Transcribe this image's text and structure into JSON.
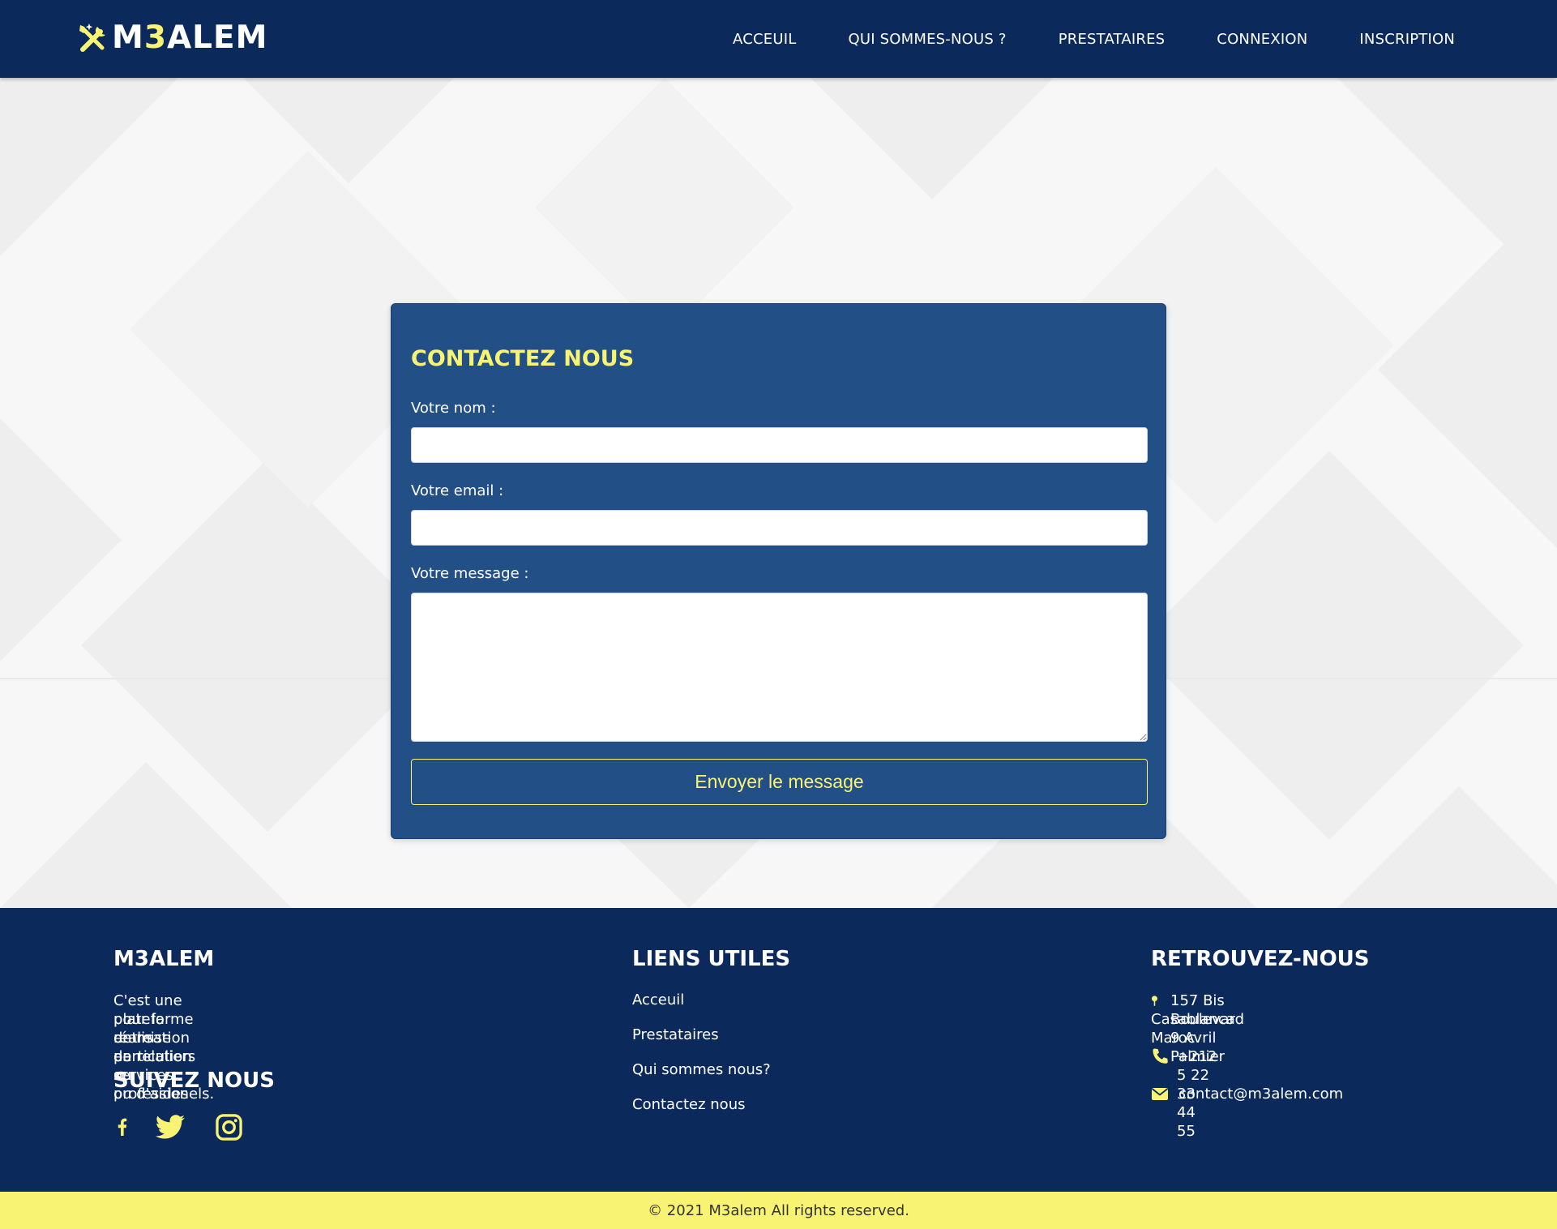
{
  "header": {
    "logo": {
      "prefix": "M",
      "accent": "3",
      "suffix": "ALEM"
    },
    "nav": [
      {
        "label": "ACCEUIL"
      },
      {
        "label": "QUI SOMMES-NOUS ?"
      },
      {
        "label": "PRESTATAIRES"
      },
      {
        "label": "CONNEXION"
      },
      {
        "label": "INSCRIPTION"
      }
    ]
  },
  "contact_form": {
    "title": "CONTACTEZ NOUS",
    "name_label": "Votre nom :",
    "name_value": "",
    "email_label": "Votre email :",
    "email_value": "",
    "message_label": "Votre message :",
    "message_value": "",
    "submit_label": "Envoyer le message"
  },
  "footer": {
    "about": {
      "heading": "M3ALEM",
      "description_lines": [
        "C'est une plateforme de mise en relation",
        "pour la réalisation de services ou d'aides",
        "entre particuliers ou professionels."
      ],
      "follow_heading": "SUIVEZ NOUS",
      "social": [
        {
          "icon": "facebook-icon"
        },
        {
          "icon": "twitter-icon"
        },
        {
          "icon": "instagram-icon"
        }
      ]
    },
    "links": {
      "heading": "LIENS UTILES",
      "items": [
        {
          "label": "Acceuil"
        },
        {
          "label": "Prestataires"
        },
        {
          "label": "Qui sommes nous?"
        },
        {
          "label": "Contactez nous"
        }
      ]
    },
    "find_us": {
      "heading": "RETROUVEZ-NOUS",
      "address_lines": [
        "157 Bis Boulevard 9 Avril Palmier",
        "Casablanca Maroc"
      ],
      "phone": "+212 5 22 33 44 55",
      "email": "contact@m3alem.com"
    }
  },
  "copyright": "© 2021 M3alem All rights reserved.",
  "colors": {
    "navy": "#0b2a5b",
    "card_blue": "#234f87",
    "accent_yellow": "#f8f373",
    "white": "#ffffff"
  }
}
